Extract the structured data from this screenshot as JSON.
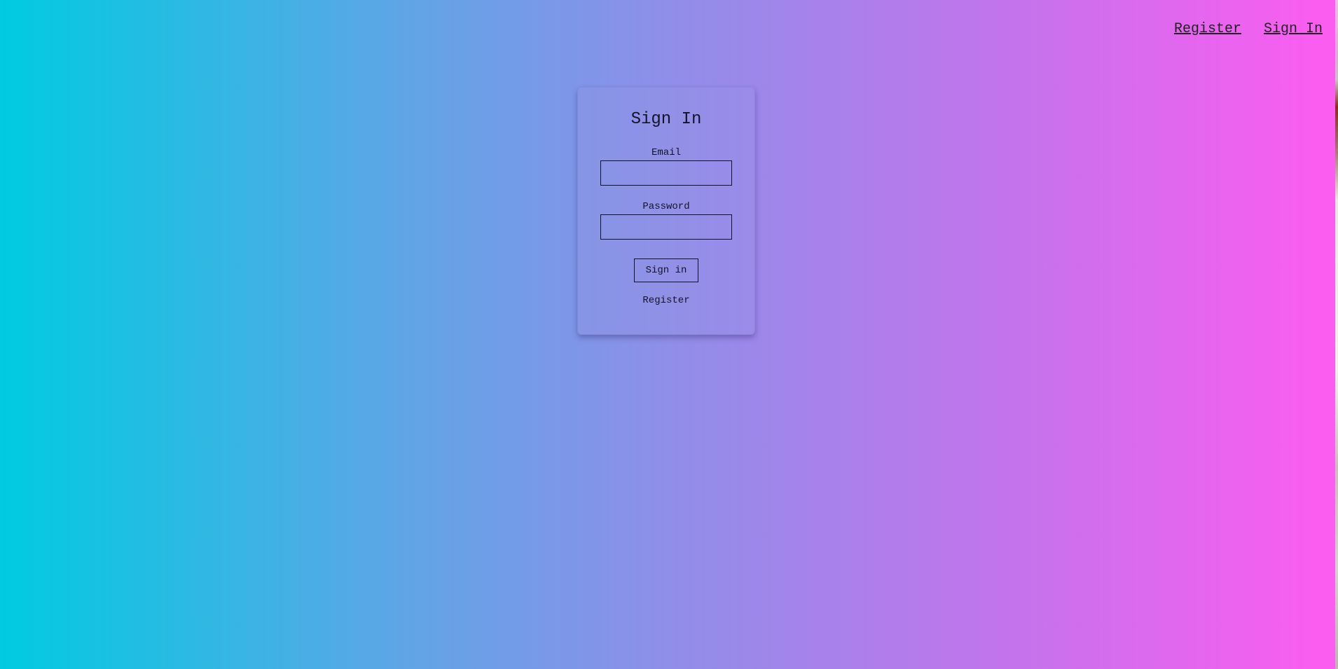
{
  "nav": {
    "register_label": "Register",
    "signin_label": "Sign In"
  },
  "card": {
    "title": "Sign In",
    "email_label": "Email",
    "email_value": "",
    "password_label": "Password",
    "password_value": "",
    "submit_label": "Sign in",
    "register_link_label": "Register"
  },
  "colors": {
    "gradient_start": "#00cbe0",
    "gradient_end": "#fd5cf1",
    "text": "#141428"
  }
}
